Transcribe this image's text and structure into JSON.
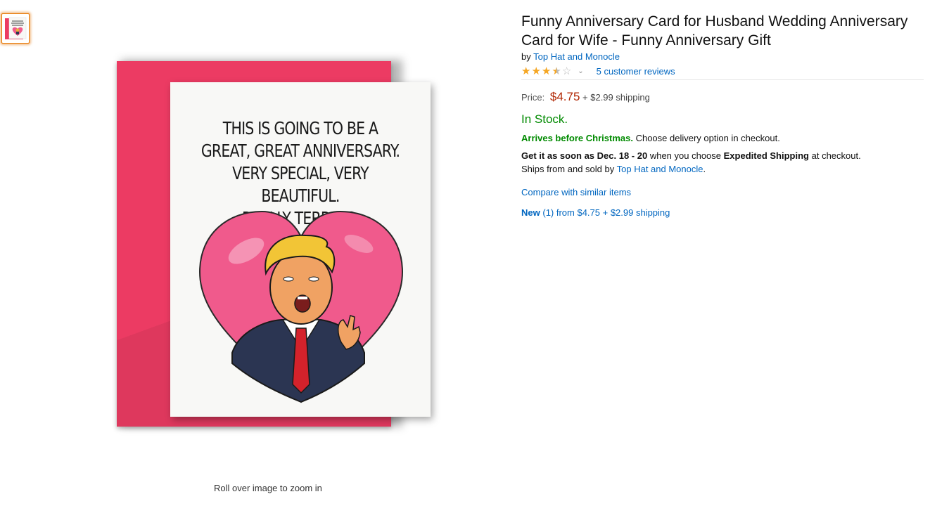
{
  "card": {
    "lines": [
      "THIS IS GOING TO BE A",
      "GREAT, GREAT ANNIVERSARY.",
      "VERY SPECIAL, VERY BEAUTIFUL.",
      "REALLY TERRIFIC."
    ]
  },
  "zoom_hint": "Roll over image to zoom in",
  "product": {
    "title": "Funny Anniversary Card for Husband Wedding Anniversary Card for Wife - Funny Anniversary Gift",
    "by_prefix": "by",
    "brand": "Top Hat and Monocle",
    "rating": 3.5,
    "reviews_link": "5 customer reviews",
    "price_label": "Price:",
    "price": "$4.75",
    "shipping": "+ $2.99 shipping",
    "stock": "In Stock.",
    "arrives_bold": "Arrives before Christmas.",
    "arrives_rest": "Choose delivery option in checkout.",
    "get_it_bold": "Get it as soon as Dec. 18 - 20",
    "get_it_mid": "when you choose",
    "get_it_ship": "Expedited Shipping",
    "get_it_end": "at checkout.",
    "ships_prefix": "Ships from and sold by",
    "seller": "Top Hat and Monocle",
    "ships_suffix": ".",
    "compare": "Compare with similar items",
    "new_label": "New",
    "new_count": "(1) from $4.75 + $2.99 shipping"
  },
  "colors": {
    "link": "#0066c0",
    "price": "#b12704",
    "stock": "#008a00",
    "envelope": "#ec3b63",
    "heart": "#f05a8c",
    "star": "#f5a623"
  }
}
